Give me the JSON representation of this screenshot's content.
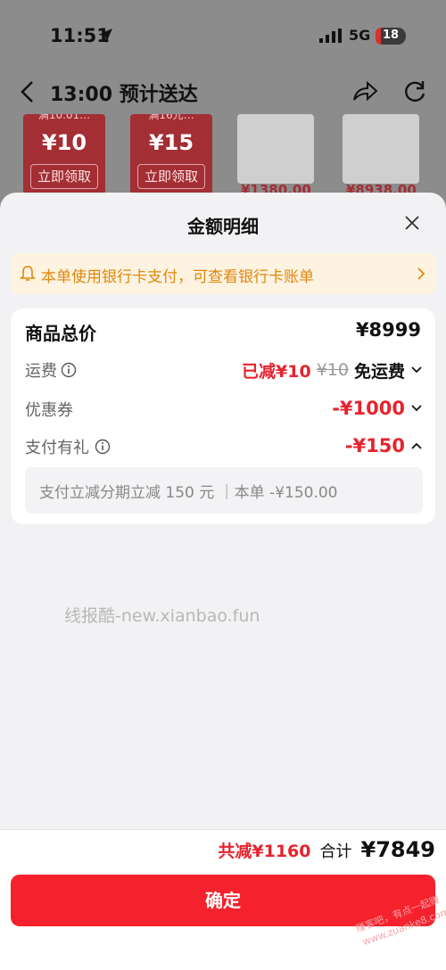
{
  "status_bar": {
    "time": "11:51",
    "network": "5G",
    "battery": "18"
  },
  "nav": {
    "title": "13:00 预计送达"
  },
  "promos": {
    "coupons": [
      {
        "top": "满10.01…",
        "amount": "¥10",
        "button": "立即领取"
      },
      {
        "top": "满16元…",
        "amount": "¥15",
        "button": "立即领取"
      }
    ],
    "products": [
      {
        "price": "¥1380.00"
      },
      {
        "price": "¥8938.00"
      }
    ]
  },
  "sheet": {
    "title": "金额明细",
    "notice": "本单使用银行卡支付，可查看银行卡账单",
    "rows": {
      "total_label": "商品总价",
      "total_value": "¥8999",
      "shipping_label": "运费",
      "shipping_reduced": "已减¥10",
      "shipping_original": "¥10",
      "shipping_free": "免运费",
      "coupon_label": "优惠券",
      "coupon_value": "-¥1000",
      "gift_label": "支付有礼",
      "gift_value": "-¥150",
      "gift_detail": "支付立减分期立减 150 元 ｜本单 -¥150.00"
    },
    "watermark": "线报酷-new.xianbao.fun",
    "footer": {
      "saved": "共减¥1160",
      "total_label": "合计",
      "total_amount": "¥7849",
      "confirm": "确定",
      "corner_mark_1": "赚客吧，有点一起赚",
      "corner_mark_2": "www.zuanke8.com"
    }
  },
  "colors": {
    "accent_red": "#f5222d",
    "discount_red": "#e5242f",
    "notice_orange": "#e2870e",
    "notice_bg": "#fdf3e0"
  },
  "icons": [
    "location-arrow-icon",
    "signal-icon",
    "battery-icon",
    "back-icon",
    "share-icon",
    "refresh-icon",
    "close-icon",
    "bell-icon",
    "chevron-right-icon",
    "info-icon",
    "chevron-down-icon",
    "chevron-up-icon"
  ]
}
